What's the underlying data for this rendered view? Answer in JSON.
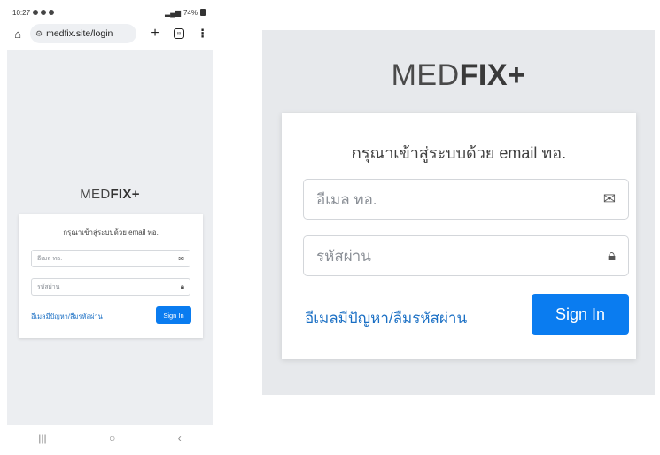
{
  "phone": {
    "status": {
      "time": "10:27",
      "battery": "74%"
    },
    "browser": {
      "url": "medfix.site/login",
      "tabs_count": "∞"
    },
    "brand": {
      "light": "MED",
      "bold": "FIX+"
    },
    "form": {
      "prompt": "กรุณาเข้าสู่ระบบด้วย email ทอ.",
      "email_placeholder": "อีเมล ทอ.",
      "password_placeholder": "รหัสผ่าน",
      "forgot_link": "อีเมลมีปัญหา/ลืมรหัสผ่าน",
      "signin_label": "Sign In"
    },
    "navbar": {
      "recents": "|||",
      "home": "○",
      "back": "‹"
    }
  },
  "zoom": {
    "brand": {
      "light": "MED",
      "bold": "FIX+"
    },
    "form": {
      "prompt": "กรุณาเข้าสู่ระบบด้วย email ทอ.",
      "email_placeholder": "อีเมล ทอ.",
      "password_placeholder": "รหัสผ่าน",
      "forgot_link": "อีเมลมีปัญหา/ลืมรหัสผ่าน",
      "signin_label": "Sign In"
    }
  },
  "colors": {
    "accent": "#0a7cf0",
    "link": "#1a6fc4",
    "page_bg": "#e7e9ec",
    "card_bg": "#ffffff"
  },
  "icons": {
    "email": "envelope-icon",
    "password": "lock-icon",
    "home": "home-icon",
    "menu": "kebab-icon"
  }
}
